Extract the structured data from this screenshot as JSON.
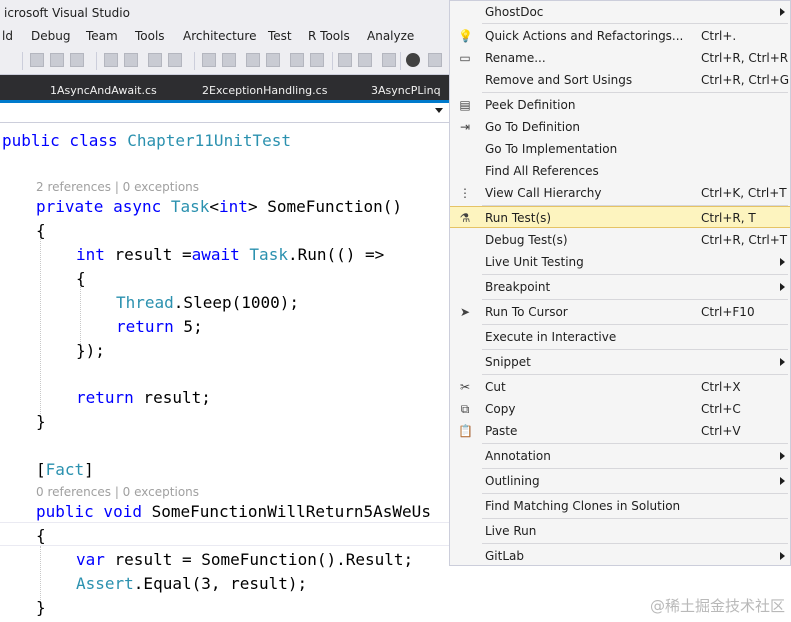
{
  "window": {
    "title": "icrosoft Visual Studio"
  },
  "menubar": [
    "ld",
    "Debug",
    "Team",
    "Tools",
    "Architecture",
    "Test",
    "R Tools",
    "Analyze"
  ],
  "tabs": [
    "1AsyncAndAwait.cs",
    "2ExceptionHandling.cs",
    "3AsyncPLinq"
  ],
  "code": {
    "l1a": "public class ",
    "l1b": "Chapter11UnitTest",
    "lens1": "2 references | 0 exceptions",
    "l2a": "private async ",
    "l2b": "Task",
    "l2c": "<",
    "l2d": "int",
    "l2e": "> SomeFunction()",
    "l3": "{",
    "l4a": "int",
    "l4b": " result =",
    "l4c": "await",
    "l4d": " ",
    "l4e": "Task",
    "l4f": ".Run(() =>",
    "l5": "{",
    "l6a": "Thread",
    "l6b": ".Sleep(1000);",
    "l7a": "return",
    "l7b": " 5;",
    "l8": "});",
    "l9a": "return",
    "l9b": " result;",
    "l10": "}",
    "l11a": "[",
    "l11b": "Fact",
    "l11c": "]",
    "lens2": "0 references | 0 exceptions",
    "l12a": "public void ",
    "l12b": "SomeFunctionWillReturn5AsWeUs",
    "l13": "{",
    "l14a": "var",
    "l14b": " result = SomeFunction().Result;",
    "l15a": "Assert",
    "l15b": ".Equal(3, result);",
    "l16": "}"
  },
  "context_menu": {
    "items": [
      {
        "label": "GhostDoc",
        "shortcut": "",
        "icon": ""
      },
      {
        "label": "Quick Actions and Refactorings...",
        "shortcut": "Ctrl+.",
        "icon": "lightbulb-icon"
      },
      {
        "label": "Rename...",
        "shortcut": "Ctrl+R, Ctrl+R",
        "icon": "rename-icon"
      },
      {
        "label": "Remove and Sort Usings",
        "shortcut": "Ctrl+R, Ctrl+G",
        "icon": ""
      },
      {
        "label": "Peek Definition",
        "shortcut": "",
        "icon": "peek-definition-icon"
      },
      {
        "label": "Go To Definition",
        "shortcut": "",
        "icon": "go-to-definition-icon"
      },
      {
        "label": "Go To Implementation",
        "shortcut": "",
        "icon": ""
      },
      {
        "label": "Find All References",
        "shortcut": "",
        "icon": ""
      },
      {
        "label": "View Call Hierarchy",
        "shortcut": "Ctrl+K, Ctrl+T",
        "icon": "call-hierarchy-icon"
      },
      {
        "label": "Run Test(s)",
        "shortcut": "Ctrl+R, T",
        "icon": "flask-icon"
      },
      {
        "label": "Debug Test(s)",
        "shortcut": "Ctrl+R, Ctrl+T",
        "icon": ""
      },
      {
        "label": "Live Unit Testing",
        "shortcut": "",
        "icon": ""
      },
      {
        "label": "Breakpoint",
        "shortcut": "",
        "icon": ""
      },
      {
        "label": "Run To Cursor",
        "shortcut": "Ctrl+F10",
        "icon": "cursor-arrow-icon"
      },
      {
        "label": "Execute in Interactive",
        "shortcut": "",
        "icon": ""
      },
      {
        "label": "Snippet",
        "shortcut": "",
        "icon": ""
      },
      {
        "label": "Cut",
        "shortcut": "Ctrl+X",
        "icon": "scissors-icon"
      },
      {
        "label": "Copy",
        "shortcut": "Ctrl+C",
        "icon": "copy-icon"
      },
      {
        "label": "Paste",
        "shortcut": "Ctrl+V",
        "icon": "paste-icon"
      },
      {
        "label": "Annotation",
        "shortcut": "",
        "icon": ""
      },
      {
        "label": "Outlining",
        "shortcut": "",
        "icon": ""
      },
      {
        "label": "Find Matching Clones in Solution",
        "shortcut": "",
        "icon": ""
      },
      {
        "label": "Live Run",
        "shortcut": "",
        "icon": ""
      },
      {
        "label": "GitLab",
        "shortcut": "",
        "icon": ""
      }
    ]
  },
  "watermark": "@稀土掘金技术社区"
}
